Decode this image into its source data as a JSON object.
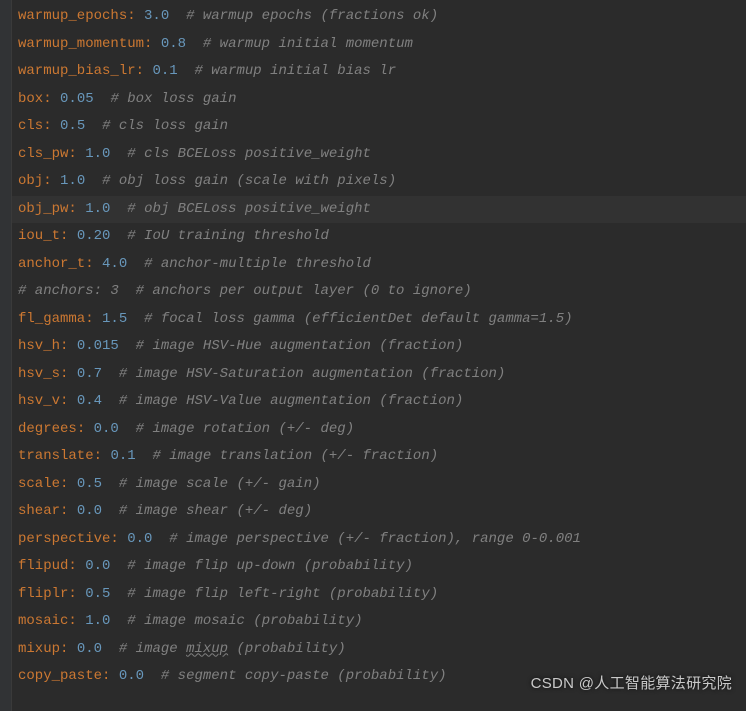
{
  "lines": [
    {
      "key": "warmup_epochs",
      "val": "3.0",
      "comment": "# warmup epochs (fractions ok)"
    },
    {
      "key": "warmup_momentum",
      "val": "0.8",
      "comment": "# warmup initial momentum"
    },
    {
      "key": "warmup_bias_lr",
      "val": "0.1",
      "comment": "# warmup initial bias lr"
    },
    {
      "key": "box",
      "val": "0.05",
      "comment": "# box loss gain"
    },
    {
      "key": "cls",
      "val": "0.5",
      "comment": "# cls loss gain"
    },
    {
      "key": "cls_pw",
      "val": "1.0",
      "comment": "# cls BCELoss positive_weight"
    },
    {
      "key": "obj",
      "val": "1.0",
      "comment": "# obj loss gain (scale with pixels)"
    },
    {
      "key": "obj_pw",
      "val": "1.0",
      "comment": "# obj BCELoss positive_weight",
      "hl": true
    },
    {
      "key": "iou_t",
      "val": "0.20",
      "comment": "# IoU training threshold"
    },
    {
      "key": "anchor_t",
      "val": "4.0",
      "comment": "# anchor-multiple threshold"
    },
    {
      "fullcomment": "# anchors: 3  # anchors per output layer (0 to ignore)"
    },
    {
      "key": "fl_gamma",
      "val": "1.5",
      "comment": "# focal loss gamma (efficientDet default gamma=1.5)"
    },
    {
      "key": "hsv_h",
      "val": "0.015",
      "comment": "# image HSV-Hue augmentation (fraction)"
    },
    {
      "key": "hsv_s",
      "val": "0.7",
      "comment": "# image HSV-Saturation augmentation (fraction)"
    },
    {
      "key": "hsv_v",
      "val": "0.4",
      "comment": "# image HSV-Value augmentation (fraction)"
    },
    {
      "key": "degrees",
      "val": "0.0",
      "comment": "# image rotation (+/- deg)"
    },
    {
      "key": "translate",
      "val": "0.1",
      "comment": "# image translation (+/- fraction)"
    },
    {
      "key": "scale",
      "val": "0.5",
      "comment": "# image scale (+/- gain)"
    },
    {
      "key": "shear",
      "val": "0.0",
      "comment": "# image shear (+/- deg)"
    },
    {
      "key": "perspective",
      "val": "0.0",
      "comment": "# image perspective (+/- fraction), range 0-0.001"
    },
    {
      "key": "flipud",
      "val": "0.0",
      "comment": "# image flip up-down (probability)"
    },
    {
      "key": "fliplr",
      "val": "0.5",
      "comment": "# image flip left-right (probability)"
    },
    {
      "key": "mosaic",
      "val": "1.0",
      "comment": "# image mosaic (probability)"
    },
    {
      "key": "mixup",
      "val": "0.0",
      "comment_pre": "# image ",
      "comment_wavy": "mixup",
      "comment_post": " (probability)"
    },
    {
      "key": "copy_paste",
      "val": "0.0",
      "comment": "# segment copy-paste (probability)"
    }
  ],
  "watermark": "CSDN @人工智能算法研究院"
}
